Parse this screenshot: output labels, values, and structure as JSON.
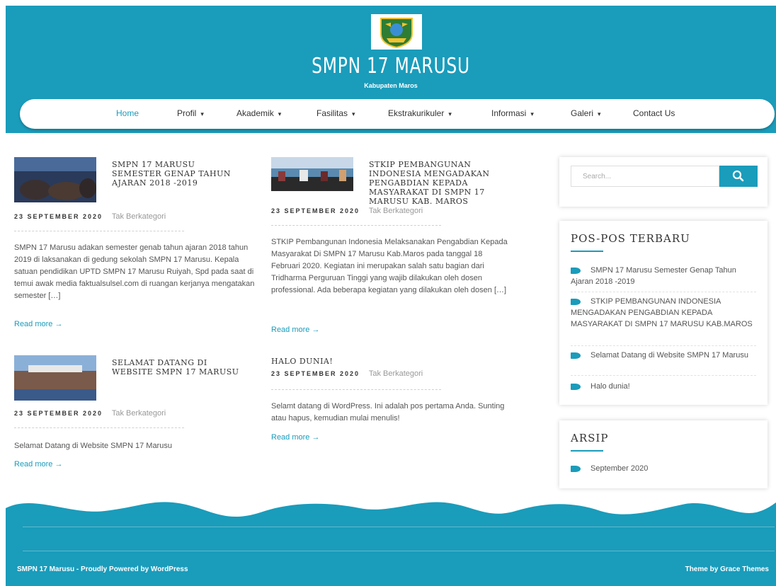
{
  "site": {
    "title": "SMPN 17 MARUSU",
    "subtitle": "Kabupaten Maros"
  },
  "nav": {
    "items": [
      "Home",
      "Profil",
      "Akademik",
      "Fasilitas",
      "Ekstrakurikuler",
      "Informasi",
      "Galeri",
      "Contact Us"
    ],
    "active": "Home"
  },
  "posts": [
    {
      "title": "SMPN 17 Marusu Semester Genap Tahun Ajaran 2018 -2019",
      "date": "23 SEPTEMBER 2020",
      "category": "Tak Berkategori",
      "excerpt": "SMPN 17 Marusu adakan semester genab tahun ajaran 2018 tahun 2019 di laksanakan di gedung sekolah SMPN 17 Marusu. Kepala satuan pendidikan UPTD SMPN 17 Marusu Ruiyah, Spd pada saat di temui awak media faktualsulsel.com di ruangan kerjanya mengatakan semester […]",
      "read_more": "Read more →"
    },
    {
      "title": "STKIP PEMBANGUNAN INDONESIA MENGADAKAN PENGABDIAN KEPADA MASYARAKAT DI SMPN 17 MARUSU KAB. MAROS",
      "date": "23 SEPTEMBER 2020",
      "category": "Tak Berkategori",
      "excerpt": "STKIP Pembangunan Indonesia Melaksanakan Pengabdian Kepada Masyarakat Di SMPN 17 Marusu Kab.Maros pada tanggal 18 Februari 2020. Kegiatan ini merupakan salah satu bagian dari Tridharma Perguruan Tinggi yang wajib dilakukan oleh dosen professional. Ada beberapa kegiatan yang dilakukan oleh dosen […]",
      "read_more": "Read more →"
    },
    {
      "title": "Selamat Datang di Website SMPN 17 Marusu",
      "date": "23 SEPTEMBER 2020",
      "category": "Tak Berkategori",
      "excerpt": "Selamat Datang di Website SMPN 17 Marusu",
      "read_more": "Read more →"
    },
    {
      "title": "Halo dunia!",
      "date": "23 SEPTEMBER 2020",
      "category": "Tak Berkategori",
      "excerpt": "Selamt datang di WordPress. Ini adalah pos pertama Anda. Sunting atau hapus, kemudian mulai menulis!",
      "read_more": "Read more →"
    }
  ],
  "sidebar": {
    "search_placeholder": "Search...",
    "recent_title": "Pos-pos Terbaru",
    "recent": [
      "SMPN 17 Marusu Semester Genap Tahun Ajaran 2018 -2019",
      "STKIP PEMBANGUNAN INDONESIA MENGADAKAN PENGABDIAN KEPADA MASYARAKAT DI SMPN 17 MARUSU KAB.MAROS",
      "Selamat Datang di Website SMPN 17 Marusu",
      "Halo dunia!"
    ],
    "archive_title": "Arsip",
    "archive": [
      "September 2020"
    ]
  },
  "footer": {
    "left": "SMPN 17 Marusu - Proudly Powered by WordPress",
    "right": "Theme by Grace Themes"
  },
  "colors": {
    "accent": "#1a9cbb"
  },
  "icons": [
    "search-icon",
    "tag-icon",
    "school-logo",
    "caret-down-icon",
    "arrow-right-icon"
  ]
}
